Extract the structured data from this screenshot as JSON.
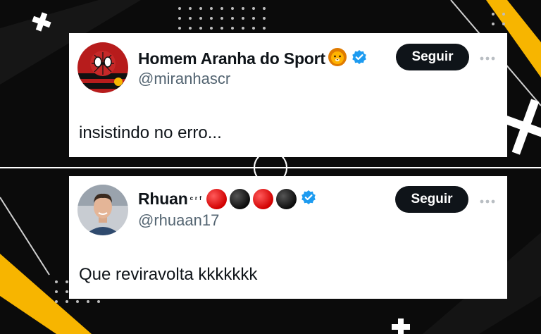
{
  "tweets": [
    {
      "display_name": "Homem Aranha do Sport",
      "emoji": "lion-face-emoji",
      "verified_icon": "verified-badge-icon",
      "handle": "@miranhascr",
      "follow_label": "Seguir",
      "more_icon": "more-options-icon",
      "text": "insistindo no erro..."
    },
    {
      "display_name": "Rhuan",
      "superscript": "ᶜʳᶠ",
      "emoji_dots": [
        "red",
        "black",
        "red",
        "black"
      ],
      "verified_icon": "verified-badge-icon",
      "handle": "@rhuaan17",
      "follow_label": "Seguir",
      "more_icon": "more-options-icon",
      "text": "Que reviravolta kkkkkkk"
    }
  ],
  "colors": {
    "background": "#0b0b0b",
    "accent_yellow": "#f7b500",
    "follow_button": "#0f1419",
    "verified_blue": "#1d9bf0",
    "handle_gray": "#536471"
  }
}
